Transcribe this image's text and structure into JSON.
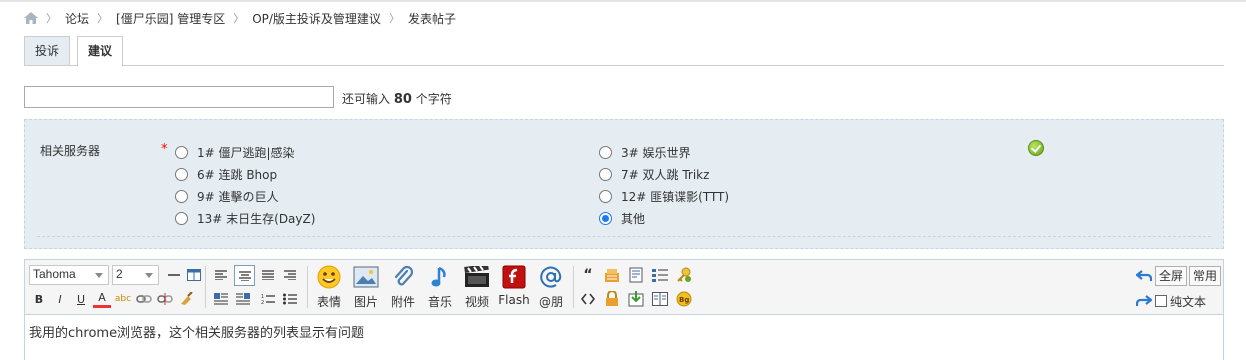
{
  "breadcrumb": {
    "items": [
      "论坛",
      "[僵尸乐园] 管理专区",
      "OP/版主投诉及管理建议",
      "发表帖子"
    ]
  },
  "tabs": [
    {
      "label": "投诉"
    },
    {
      "label": "建议"
    }
  ],
  "subject": {
    "value": "",
    "counter_prefix": "还可输入",
    "counter_value": "80",
    "counter_suffix": "个字符"
  },
  "server_field": {
    "label": "相关服务器",
    "required_mark": "*",
    "options": [
      {
        "label": "1# 僵尸逃跑|感染",
        "checked": false
      },
      {
        "label": "3# 娱乐世界",
        "checked": false
      },
      {
        "label": "6# 连跳 Bhop",
        "checked": false
      },
      {
        "label": "7# 双人跳 Trikz",
        "checked": false
      },
      {
        "label": "9# 進擊の巨人",
        "checked": false
      },
      {
        "label": "12# 匪镇谍影(TTT)",
        "checked": false
      },
      {
        "label": "13# 末日生存(DayZ)",
        "checked": false
      },
      {
        "label": "其他",
        "checked": true
      }
    ],
    "status_icon": "check-icon"
  },
  "editor": {
    "font": "Tahoma",
    "size": "2",
    "insert_buttons": [
      {
        "label": "表情",
        "icon": "smiley-icon"
      },
      {
        "label": "图片",
        "icon": "image-icon"
      },
      {
        "label": "附件",
        "icon": "paperclip-icon"
      },
      {
        "label": "音乐",
        "icon": "music-icon"
      },
      {
        "label": "视频",
        "icon": "video-icon"
      },
      {
        "label": "Flash",
        "icon": "flash-icon"
      },
      {
        "label": "@朋",
        "icon": "at-icon"
      }
    ],
    "fullscreen_label": "全屏",
    "common_label": "常用",
    "plain_text_label": "纯文本",
    "content": "我用的chrome浏览器，这个相关服务器的列表显示有问题",
    "colors": {
      "accent": "#1a7cf0",
      "panel_bg": "#e5edf2",
      "panel_border": "#c2d5e3"
    }
  }
}
